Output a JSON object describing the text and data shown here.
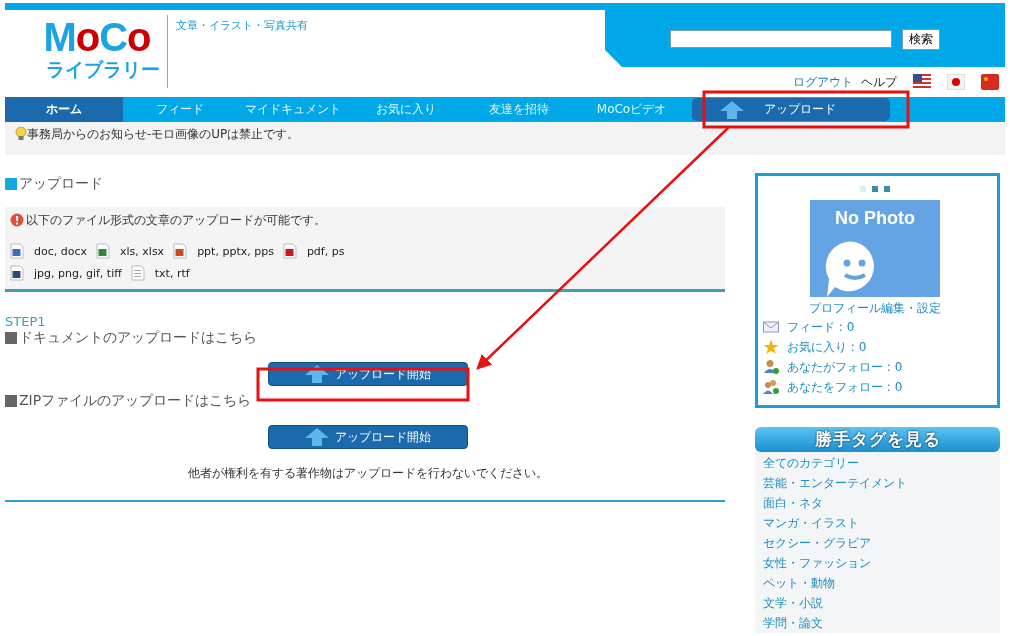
{
  "logo": {
    "letters": [
      {
        "text": "M",
        "color": "#1ba3e3"
      },
      {
        "text": "o",
        "color": "#cc0000"
      },
      {
        "text": "C",
        "color": "#1ba3e3"
      },
      {
        "text": "o",
        "color": "#cc0000"
      }
    ],
    "sub": "ライブラリー"
  },
  "tagline": "文章・イラスト・写真共有",
  "search": {
    "button": "検索"
  },
  "top_links": [
    "ログアウト",
    "ヘルプ"
  ],
  "nav": [
    {
      "label": "ホーム",
      "selected": true,
      "kind": "tab"
    },
    {
      "label": "フィード",
      "selected": false,
      "kind": "tab"
    },
    {
      "label": "マイドキュメント",
      "selected": false,
      "kind": "tab"
    },
    {
      "label": "お気に入り",
      "selected": false,
      "kind": "tab"
    },
    {
      "label": "友達を招待",
      "selected": false,
      "kind": "tab"
    },
    {
      "label": "MoCoビデオ",
      "selected": false,
      "kind": "tab"
    },
    {
      "label": "アップロード",
      "selected": false,
      "kind": "upload"
    }
  ],
  "notice": "事務局からのお知らせ-モロ画像のUPは禁止です。",
  "section_title": "アップロード",
  "formats_note": "以下のファイル形式の文章のアップロードが可能です。",
  "formats": [
    [
      {
        "kind": "word",
        "label": "doc, docx"
      },
      {
        "kind": "excel",
        "label": "xls, xlsx"
      },
      {
        "kind": "powerpoint",
        "label": "ppt, pptx, pps"
      },
      {
        "kind": "pdf",
        "label": "pdf, ps"
      }
    ],
    [
      {
        "kind": "image",
        "label": "jpg, png, gif, tiff"
      },
      {
        "kind": "text",
        "label": "txt, rtf"
      }
    ]
  ],
  "step": "STEP1",
  "uploads": [
    {
      "heading": "ドキュメントのアップロードはこちら",
      "button": "アップロード開始"
    },
    {
      "heading": "ZIPファイルのアップロードはこちら",
      "button": "アップロード開始"
    }
  ],
  "disclaimer": "他者が権利を有する著作物はアップロードを行わないでください。",
  "profile": {
    "photo_text": "No Photo",
    "edit_link": "プロフィール編集・設定",
    "stats": [
      {
        "kind": "feed",
        "text": "フィード : 0"
      },
      {
        "kind": "favorite",
        "text": "お気に入り : 0"
      },
      {
        "kind": "following",
        "text": "あなたがフォロー : 0"
      },
      {
        "kind": "followers",
        "text": "あなたをフォロー : 0"
      }
    ]
  },
  "tags": {
    "title": "勝手タグを見る",
    "items": [
      "全てのカテゴリー",
      "芸能・エンターテイメント",
      "面白・ネタ",
      "マンガ・イラスト",
      "セクシー・グラビア",
      "女性・ファッション",
      "ペット・動物",
      "文学・小説",
      "学問・論文"
    ]
  }
}
